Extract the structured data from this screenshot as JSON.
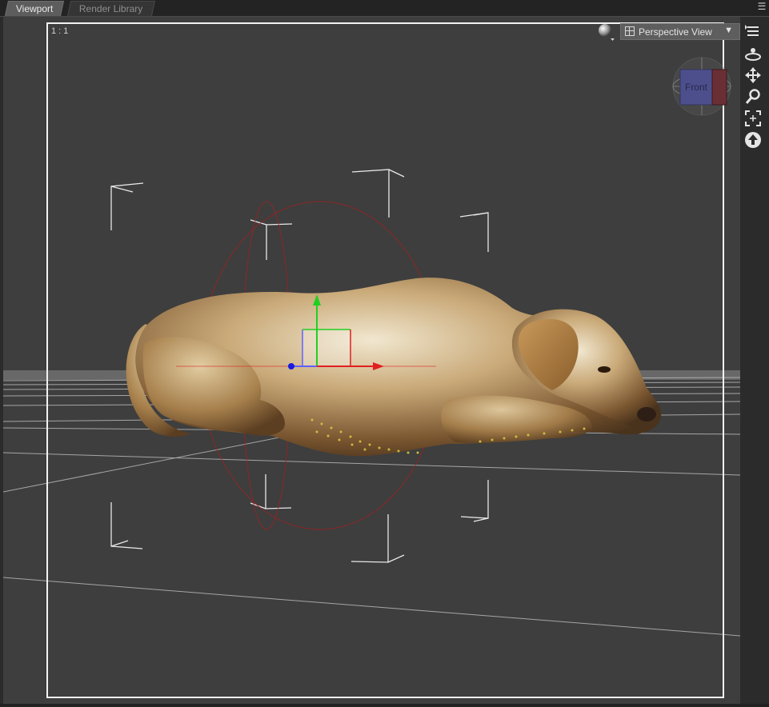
{
  "tabs": [
    {
      "label": "Viewport",
      "active": true
    },
    {
      "label": "Render Library",
      "active": false
    }
  ],
  "viewport": {
    "aspect_ratio_label": "1 : 1",
    "view_selector": "Perspective View",
    "view_cube_face": "Front",
    "selected_figure": "dog"
  },
  "tools": [
    {
      "name": "orbit-camera",
      "icon": "orbit-icon"
    },
    {
      "name": "pan-camera",
      "icon": "move-arrows-icon"
    },
    {
      "name": "zoom-camera",
      "icon": "magnifier-icon"
    },
    {
      "name": "frame-selection",
      "icon": "frame-icon"
    },
    {
      "name": "reset-view",
      "icon": "up-arrow-circle-icon"
    }
  ],
  "colors": {
    "viewport_bg": "#3e3e3e",
    "x_axis": "#e02020",
    "y_axis": "#20d020",
    "z_axis": "#2020e0",
    "selection_bounds": "#ffffff",
    "rotate_ring": "#a02020"
  }
}
